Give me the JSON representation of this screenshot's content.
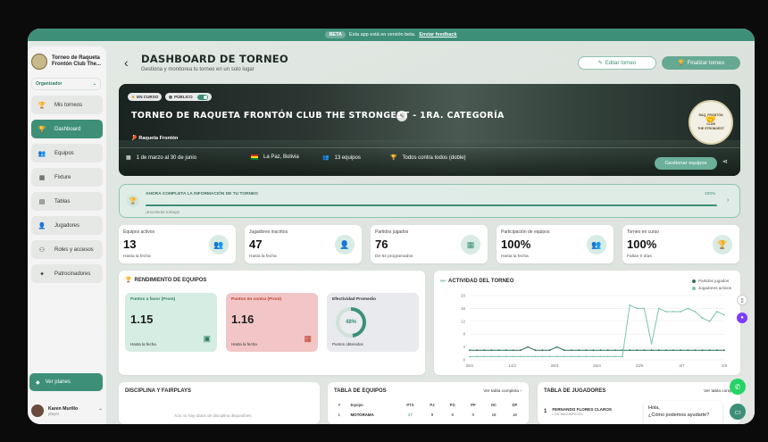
{
  "beta": {
    "pill": "BETA",
    "text": "Esta app está en versión beta.",
    "link": "Enviar feedback"
  },
  "sidebar": {
    "club_name": "Torneo de Raqueta Frontón Club The...",
    "role": "Organizador",
    "items": [
      {
        "label": "Mis torneos",
        "icon": "trophy-icon",
        "active": false
      },
      {
        "label": "Dashboard",
        "icon": "trophy-icon",
        "active": true
      },
      {
        "label": "Equipos",
        "icon": "team-icon",
        "active": false
      },
      {
        "label": "Fixture",
        "icon": "calendar-icon",
        "active": false
      },
      {
        "label": "Tablas",
        "icon": "table-icon",
        "active": false
      },
      {
        "label": "Jugadores",
        "icon": "user-icon",
        "active": false
      },
      {
        "label": "Roles y accesos",
        "icon": "roles-icon",
        "active": false
      },
      {
        "label": "Patrocinadores",
        "icon": "sponsor-icon",
        "active": false
      }
    ],
    "upgrade": "Ver planes",
    "user": {
      "name": "Karen Murillo",
      "role": "player"
    }
  },
  "header": {
    "title": "DASHBOARD DE TORNEO",
    "subtitle": "Gestiona y monitorea tu torneo en un solo lugar",
    "edit": "Editar torneo",
    "finish": "Finalizar torneo"
  },
  "hero": {
    "status": "EN CURSO",
    "visibility": "PÚBLICO",
    "title": "TORNEO DE RAQUETA FRONTÓN CLUB THE STRONGEST - 1RA. CATEGORÍA",
    "sport": "Raqueta Frontón",
    "dates": "1 de marzo al 30 de junio",
    "location": "La Paz, Bolivia",
    "teams": "13 equipos",
    "format": "Todos contra todos (doble)",
    "manage": "Gestionar equipos",
    "seal": {
      "top": "RAQ. FRONTÓN",
      "mid": "CLUB",
      "bottom": "THE STRONGEST"
    }
  },
  "progress": {
    "title": "AHORA COMPLETA LA INFORMACIÓN DE TU TORNEO",
    "sub": "¡Excelente trabajo!",
    "pct": "100%",
    "value": 1.0
  },
  "kpis": [
    {
      "label": "Equipos activos",
      "value": "13",
      "sub": "Hasta la fecha",
      "icon": "team-icon"
    },
    {
      "label": "Jugadores inscritos",
      "value": "47",
      "sub": "Hasta la fecha",
      "icon": "user-icon"
    },
    {
      "label": "Partidos jugados",
      "value": "76",
      "sub": "De 84 programados",
      "icon": "calendar-icon"
    },
    {
      "label": "Participación de equipos",
      "value": "100%",
      "sub": "Hasta la fecha",
      "icon": "team-icon"
    },
    {
      "label": "Torneo en curso",
      "value": "100%",
      "sub": "Faltan 0 días",
      "icon": "trophy-icon"
    }
  ],
  "rendimiento": {
    "title": "RENDIMIENTO DE EQUIPOS",
    "favor": {
      "label": "Puntos a favor (Prom)",
      "value": "1.15",
      "sub": "Hasta la fecha"
    },
    "contra": {
      "label": "Puntos en contra (Prom)",
      "value": "1.16",
      "sub": "Hasta la fecha"
    },
    "efect": {
      "label": "Efectividad Promedio",
      "value": "48%",
      "sub": "Puntos obtenidos",
      "fraction": 0.48
    }
  },
  "actividad": {
    "title": "ACTIVIDAD DEL TORNEO",
    "legend": [
      "Partidos jugados",
      "Jugadores activos"
    ]
  },
  "chart_data": {
    "type": "line",
    "title": "ACTIVIDAD DEL TORNEO",
    "x": [
      "28/2",
      "14/3",
      "28/3",
      "25/4",
      "23/5",
      "4/7",
      "2/8"
    ],
    "ylim": [
      0,
      20
    ],
    "yticks": [
      0,
      4,
      8,
      12,
      16,
      20
    ],
    "series": [
      {
        "name": "Partidos jugados",
        "color": "#2f6e5c",
        "values": [
          3,
          3,
          3,
          3,
          3,
          3,
          3,
          3,
          4,
          3,
          3,
          3,
          4,
          3,
          3,
          3,
          3,
          3,
          3,
          3,
          3,
          3,
          3,
          3,
          3,
          3,
          3,
          3,
          3,
          3,
          3,
          3,
          3,
          3,
          3,
          3
        ]
      },
      {
        "name": "Jugadores activos",
        "color": "#7cc4a8",
        "values": [
          1,
          1,
          1,
          1,
          1,
          1,
          1,
          1,
          1,
          1,
          1,
          1,
          1,
          1,
          1,
          1,
          1,
          1,
          1,
          1,
          1,
          1,
          17,
          16,
          16,
          5,
          16,
          15,
          15,
          15,
          16,
          15,
          13,
          12,
          15,
          14
        ]
      }
    ]
  },
  "disciplina": {
    "title": "DISCIPLINA Y FAIRPLAYS",
    "empty": "Aún no hay datos de disciplina disponibles"
  },
  "tabla_equipos": {
    "title": "TABLA DE EQUIPOS",
    "link": "Ver tabla completa",
    "headers": [
      "#",
      "Equipo",
      "PTS",
      "PJ",
      "PG",
      "PP",
      "DC",
      "DP"
    ],
    "rows": [
      [
        "1",
        "MOTORAMA",
        "27",
        "9",
        "9",
        "0",
        "18",
        "18"
      ]
    ]
  },
  "tabla_jugadores": {
    "title": "TABLA DE JUGADORES",
    "link": "Ver tabla compl...",
    "rows": [
      {
        "pos": "1",
        "name": "FERNANDO FLORES CLAROS",
        "team": "LOS MAGNIFICOS"
      }
    ]
  },
  "chat": {
    "line1": "Hola,",
    "line2": "¿Cómo podemos ayudarte?"
  }
}
